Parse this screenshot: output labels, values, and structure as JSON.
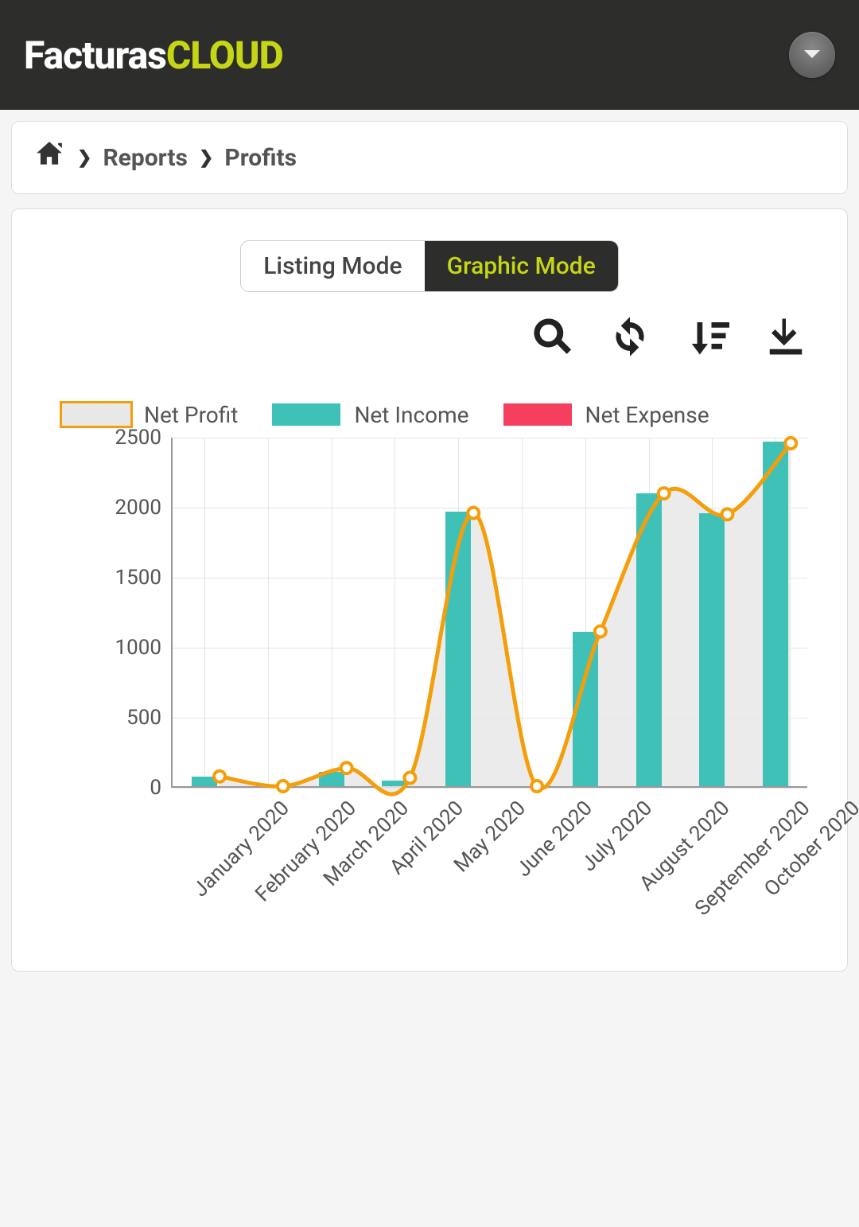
{
  "header": {
    "logo_part1": "Facturas",
    "logo_part2": "CLOUD"
  },
  "breadcrumb": {
    "item1": "Reports",
    "item2": "Profits"
  },
  "modes": {
    "listing": "Listing Mode",
    "graphic": "Graphic Mode"
  },
  "legend": {
    "profit": "Net Profit",
    "income": "Net Income",
    "expense": "Net Expense"
  },
  "chart_data": {
    "type": "bar",
    "ylim": [
      0,
      2500
    ],
    "yticks": [
      0,
      500,
      1000,
      1500,
      2000,
      2500
    ],
    "categories": [
      "January 2020",
      "February 2020",
      "March 2020",
      "April 2020",
      "May 2020",
      "June 2020",
      "July 2020",
      "August 2020",
      "September 2020",
      "October 2020"
    ],
    "series": [
      {
        "name": "Net Income",
        "type": "bar",
        "color": "#3fc1b8",
        "values": [
          70,
          0,
          100,
          40,
          1960,
          0,
          1100,
          2090,
          1950,
          2460
        ]
      },
      {
        "name": "Net Expense",
        "type": "bar",
        "color": "#f43f5e",
        "values": [
          0,
          0,
          0,
          0,
          0,
          0,
          0,
          0,
          0,
          0
        ]
      },
      {
        "name": "Net Profit",
        "type": "area-line",
        "color": "#f59e0b",
        "values": [
          70,
          0,
          130,
          60,
          1960,
          0,
          1110,
          2100,
          1950,
          2460
        ]
      }
    ]
  }
}
